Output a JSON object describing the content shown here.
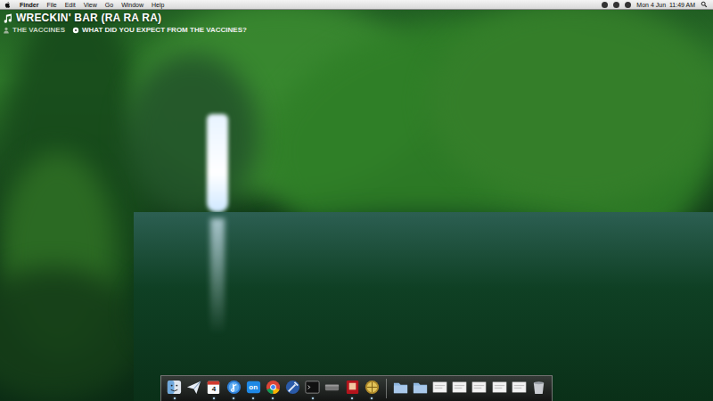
{
  "menu_bar": {
    "app": "Finder",
    "menus": [
      "File",
      "Edit",
      "View",
      "Go",
      "Window",
      "Help"
    ],
    "clock": "Mon 4 Jun  11:49 AM"
  },
  "now_playing": {
    "track": "WRECKIN' BAR (RA RA RA)",
    "artist": "THE VACCINES",
    "album": "WHAT DID YOU EXPECT FROM THE VACCINES?"
  },
  "dock": {
    "items": [
      {
        "kind": "finder",
        "running": true
      },
      {
        "kind": "mail",
        "running": false
      },
      {
        "kind": "calendar",
        "text": "4",
        "running": true
      },
      {
        "kind": "itunes",
        "running": true
      },
      {
        "kind": "badge",
        "text": "on",
        "running": true
      },
      {
        "kind": "chrome",
        "running": true
      },
      {
        "kind": "xcode",
        "running": false
      },
      {
        "kind": "terminal",
        "running": true
      },
      {
        "kind": "drive",
        "running": false
      },
      {
        "kind": "photobooth",
        "running": true
      },
      {
        "kind": "globe",
        "running": true
      },
      {
        "kind": "separator",
        "running": false
      },
      {
        "kind": "folder",
        "running": false
      },
      {
        "kind": "folder",
        "running": false
      },
      {
        "kind": "document",
        "running": false
      },
      {
        "kind": "document",
        "running": false
      },
      {
        "kind": "document",
        "running": false
      },
      {
        "kind": "document",
        "running": false
      },
      {
        "kind": "document",
        "running": false
      },
      {
        "kind": "trash",
        "running": false
      }
    ]
  }
}
